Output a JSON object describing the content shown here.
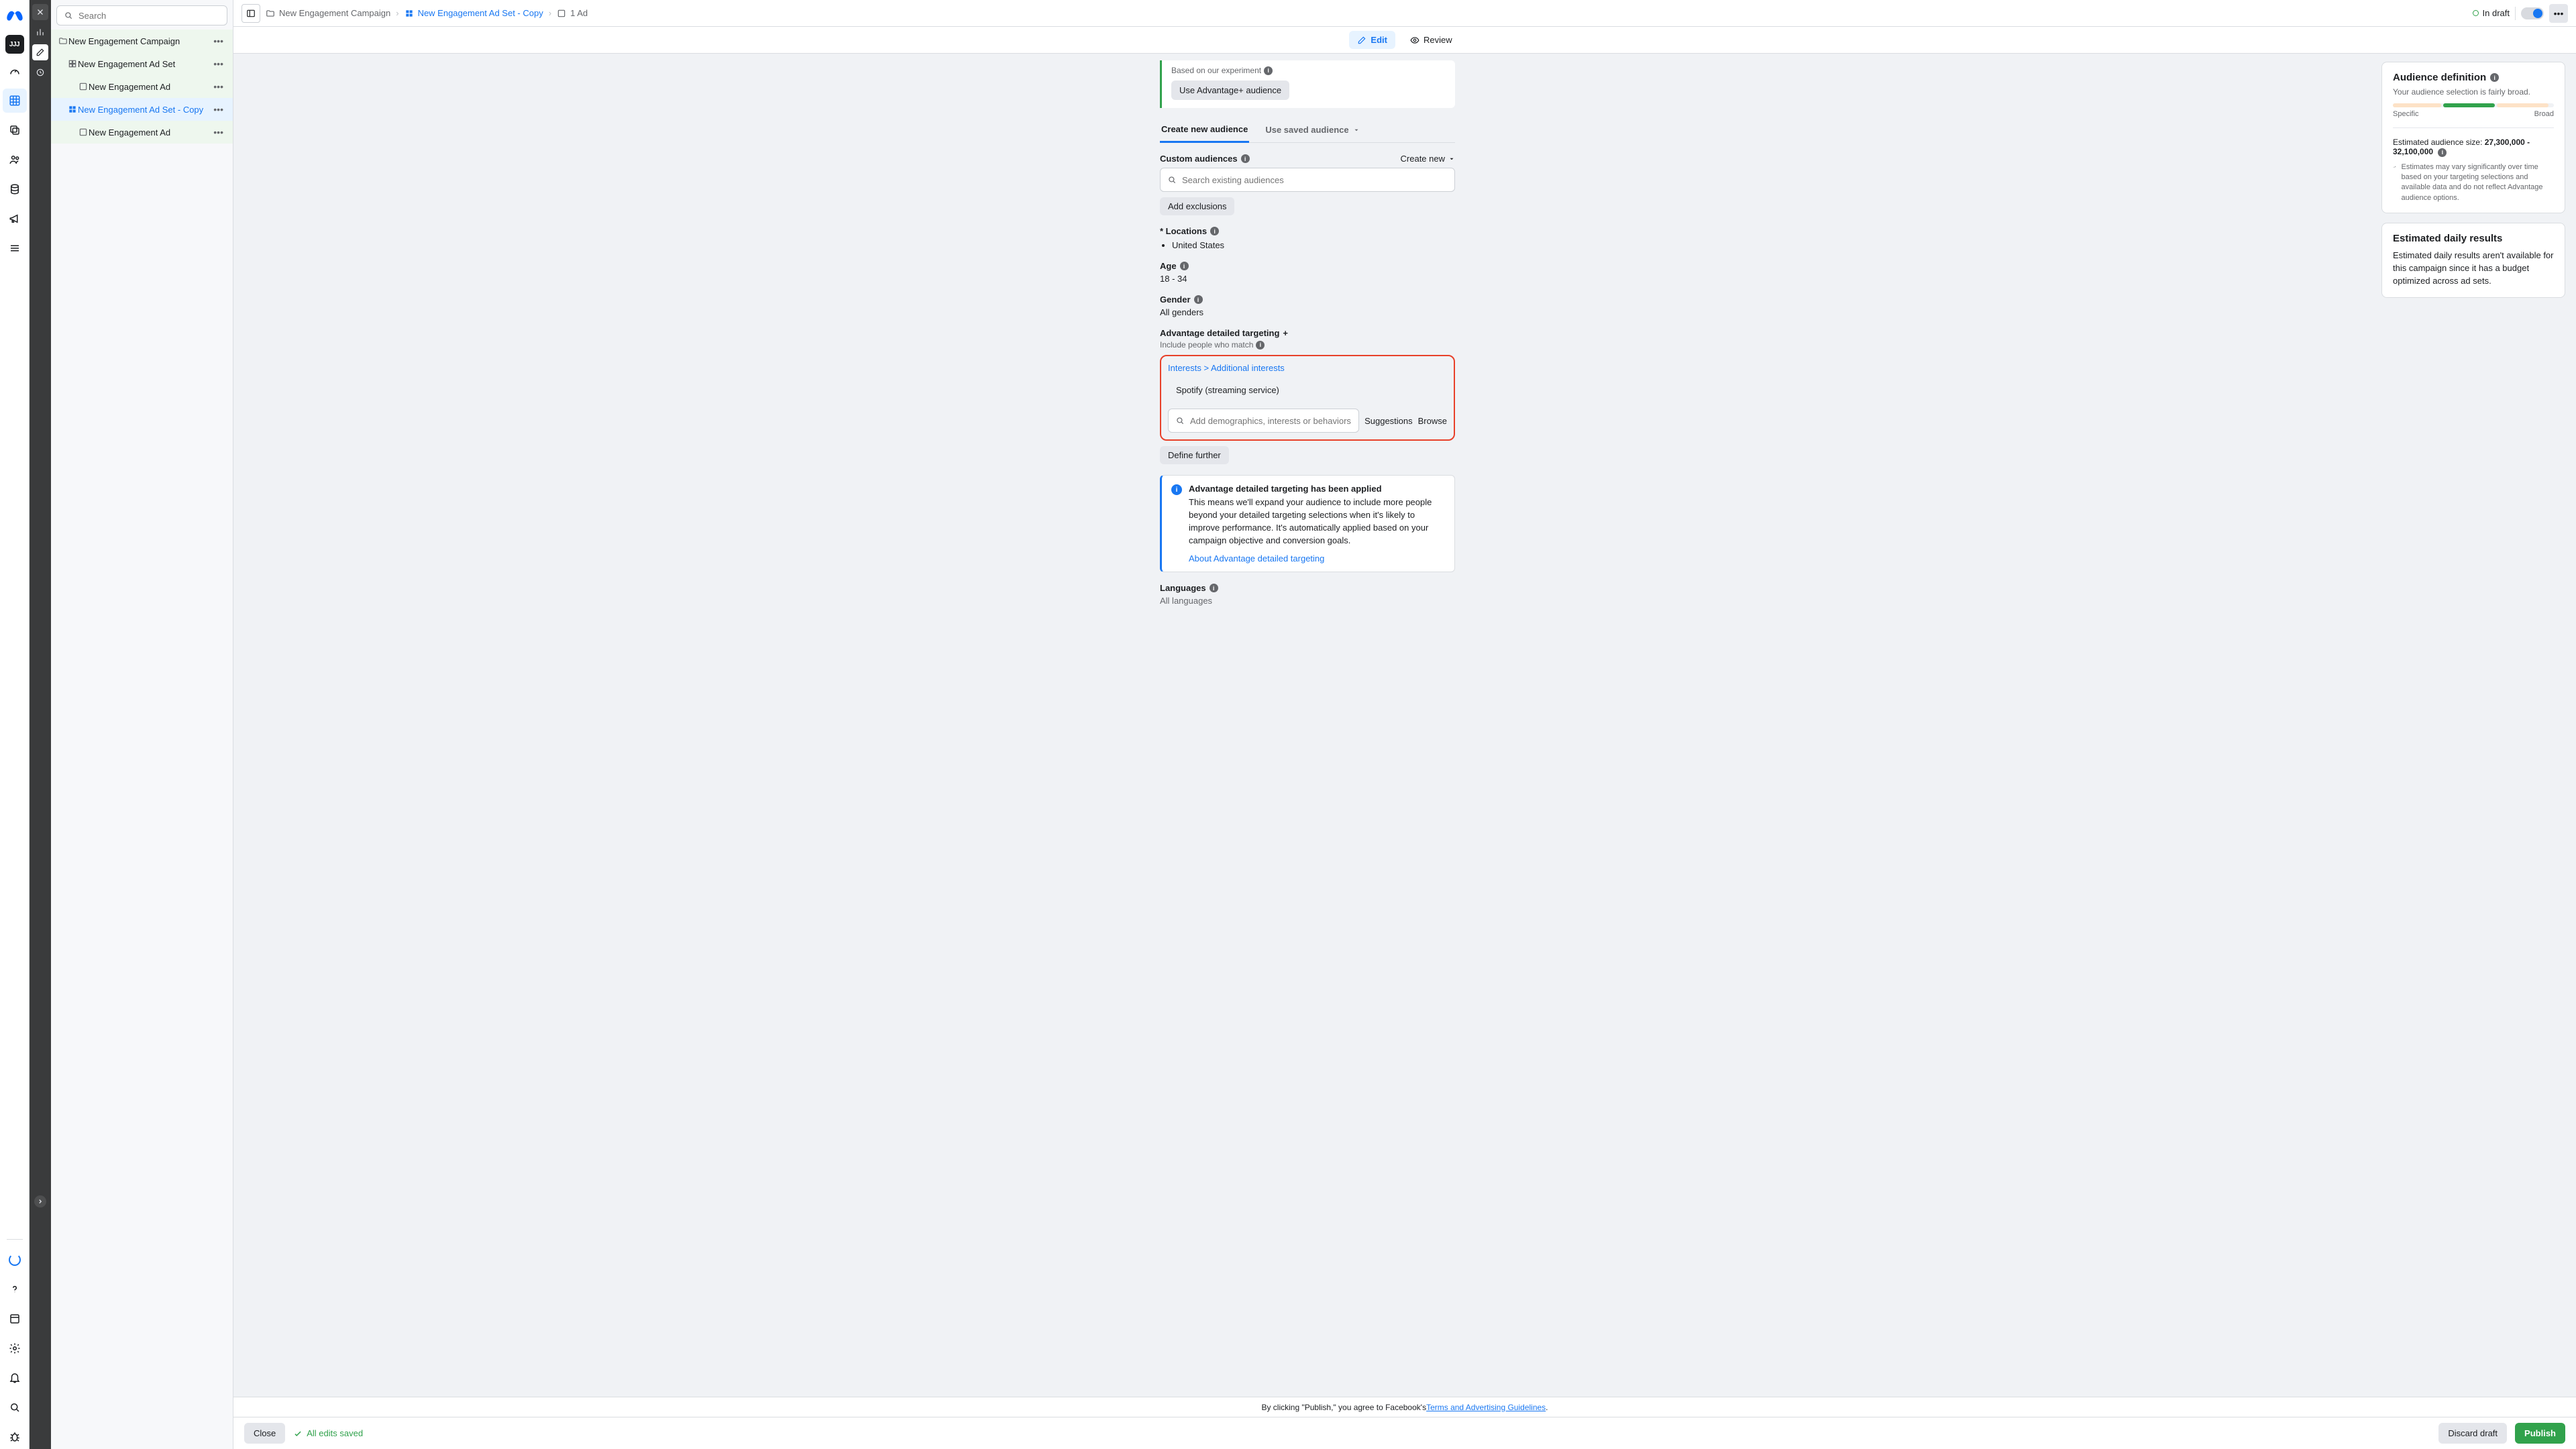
{
  "search": {
    "placeholder": "Search"
  },
  "tree": {
    "items": [
      {
        "label": "New Engagement Campaign"
      },
      {
        "label": "New Engagement Ad Set"
      },
      {
        "label": "New Engagement Ad"
      },
      {
        "label": "New Engagement Ad Set - Copy"
      },
      {
        "label": "New Engagement Ad"
      }
    ]
  },
  "breadcrumbs": {
    "campaign": "New Engagement Campaign",
    "adset": "New Engagement Ad Set - Copy",
    "ad": "1 Ad"
  },
  "draft_label": "In draft",
  "tabs": {
    "edit": "Edit",
    "review": "Review"
  },
  "hint": {
    "under": "Based on our experiment",
    "button": "Use Advantage+ audience"
  },
  "subtabs": {
    "create": "Create new audience",
    "saved": "Use saved audience"
  },
  "custom": {
    "title": "Custom audiences",
    "create_new": "Create new",
    "search_ph": "Search existing audiences",
    "add_excl": "Add exclusions"
  },
  "locations": {
    "title": "* Locations",
    "value": "United States"
  },
  "age": {
    "title": "Age",
    "value": "18 - 34"
  },
  "gender": {
    "title": "Gender",
    "value": "All genders"
  },
  "targeting": {
    "title": "Advantage detailed targeting",
    "sub": "Include people who match",
    "crumb1": "Interests",
    "crumb2": "Additional interests",
    "chip": "Spotify (streaming service)",
    "search_ph": "Add demographics, interests or behaviors",
    "suggestions": "Suggestions",
    "browse": "Browse",
    "define": "Define further"
  },
  "info": {
    "title": "Advantage detailed targeting has been applied",
    "body": "This means we'll expand your audience to include more people beyond your detailed targeting selections when it's likely to improve performance. It's automatically applied based on your campaign objective and conversion goals.",
    "link": "About Advantage detailed targeting"
  },
  "languages": {
    "title": "Languages",
    "value": "All languages"
  },
  "aud": {
    "title": "Audience definition",
    "sub": "Your audience selection is fairly broad.",
    "specific": "Specific",
    "broad": "Broad",
    "est_label": "Estimated audience size:",
    "est_value": "27,300,000 - 32,100,000",
    "note": "Estimates may vary significantly over time based on your targeting selections and available data and do not reflect Advantage audience options."
  },
  "edr": {
    "title": "Estimated daily results",
    "body": "Estimated daily results aren't available for this campaign since it has a budget optimized across ad sets."
  },
  "footer": {
    "pretext": "By clicking \"Publish,\" you agree to Facebook's ",
    "link": "Terms and Advertising Guidelines",
    "close": "Close",
    "saved": "All edits saved",
    "discard": "Discard draft",
    "publish": "Publish"
  }
}
